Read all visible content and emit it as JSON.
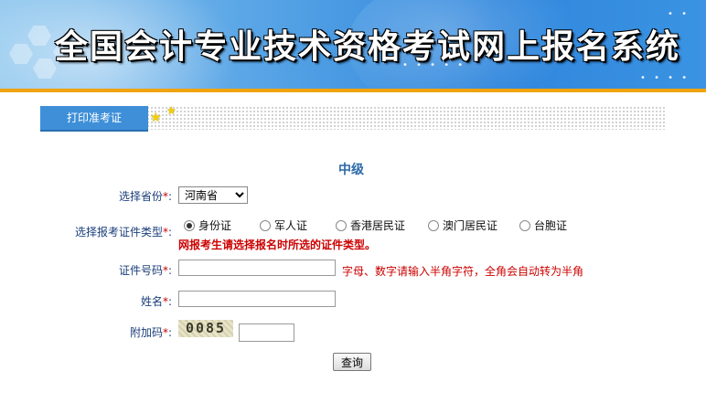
{
  "banner": {
    "title": "全国会计专业技术资格考试网上报名系统"
  },
  "tab": {
    "label": "打印准考证"
  },
  "form": {
    "level": "中级",
    "province": {
      "label": "选择省份",
      "selected": "河南省"
    },
    "id_type": {
      "label": "选择报考证件类型",
      "options": [
        "身份证",
        "军人证",
        "香港居民证",
        "澳门居民证",
        "台胞证"
      ],
      "selected": "身份证",
      "warning": "网报考生请选择报名时所选的证件类型。"
    },
    "id_number": {
      "label": "证件号码",
      "value": "",
      "hint": "字母、数字请输入半角字符，全角会自动转为半角"
    },
    "name": {
      "label": "姓名",
      "value": ""
    },
    "captcha": {
      "label": "附加码",
      "image_text": "0085",
      "value": ""
    },
    "required_mark": "*",
    "colon": ":",
    "submit_label": "查询"
  },
  "colors": {
    "accent": "#3e8fd8",
    "orange": "#f0a30a",
    "label": "#1a3e7a",
    "warning": "#cc0000"
  }
}
